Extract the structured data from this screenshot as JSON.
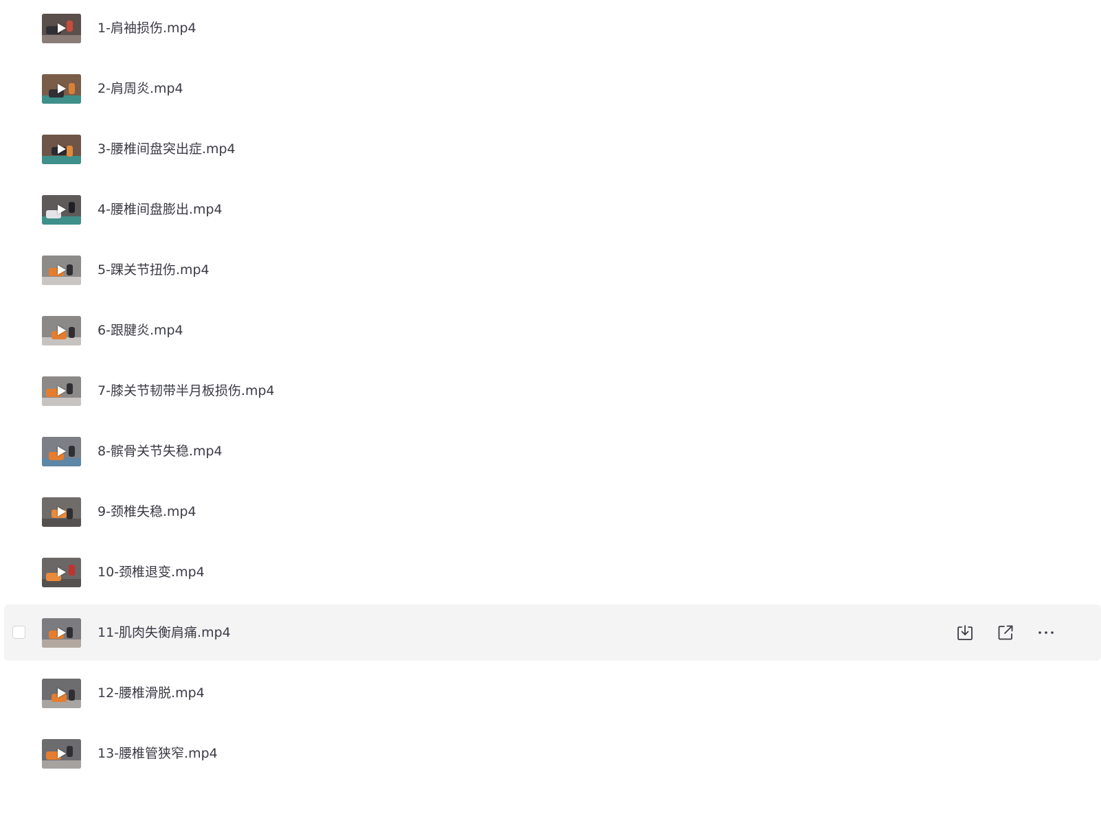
{
  "files": [
    {
      "name": "1-肩袖损伤.mp4",
      "thumb": {
        "bg": "#5b4f4c",
        "floor": "#8a7d78",
        "figure": "#2f2f35",
        "accent": "#c94c3a"
      }
    },
    {
      "name": "2-肩周炎.mp4",
      "thumb": {
        "bg": "#7a5d48",
        "floor": "#3f8f8a",
        "figure": "#2f2f35",
        "accent": "#d8803a"
      }
    },
    {
      "name": "3-腰椎间盘突出症.mp4",
      "thumb": {
        "bg": "#6e5547",
        "floor": "#3f8f8a",
        "figure": "#2a2a30",
        "accent": "#e08a3c"
      }
    },
    {
      "name": "4-腰椎间盘膨出.mp4",
      "thumb": {
        "bg": "#5e5a5a",
        "floor": "#3f8f8a",
        "figure": "#e4e4e8",
        "accent": "#1f1f25"
      }
    },
    {
      "name": "5-踝关节扭伤.mp4",
      "thumb": {
        "bg": "#8d8b89",
        "floor": "#c9c5c3",
        "figure": "#e47d2f",
        "accent": "#2f2f33"
      }
    },
    {
      "name": "6-跟腱炎.mp4",
      "thumb": {
        "bg": "#8b8987",
        "floor": "#c6c2c0",
        "figure": "#e47d2f",
        "accent": "#2f2f33"
      }
    },
    {
      "name": "7-膝关节韧带半月板损伤.mp4",
      "thumb": {
        "bg": "#8c8a88",
        "floor": "#c7c3c1",
        "figure": "#e47d2f",
        "accent": "#2f2f33"
      }
    },
    {
      "name": "8-髌骨关节失稳.mp4",
      "thumb": {
        "bg": "#7c7f86",
        "floor": "#5e86a6",
        "figure": "#e47d2f",
        "accent": "#2f2f33"
      }
    },
    {
      "name": "9-颈椎失稳.mp4",
      "thumb": {
        "bg": "#6f6c6a",
        "floor": "#55514f",
        "figure": "#ea8a3b",
        "accent": "#2f2f33"
      }
    },
    {
      "name": "10-颈椎退变.mp4",
      "thumb": {
        "bg": "#6a6766",
        "floor": "#55514f",
        "figure": "#ea8a3b",
        "accent": "#c0332f"
      }
    },
    {
      "name": "11-肌肉失衡肩痛.mp4",
      "thumb": {
        "bg": "#7c7b7f",
        "floor": "#b3a8a0",
        "figure": "#e47d2f",
        "accent": "#2f2f33"
      }
    },
    {
      "name": "12-腰椎滑脱.mp4",
      "thumb": {
        "bg": "#6d6c6e",
        "floor": "#a8a4a2",
        "figure": "#e47d2f",
        "accent": "#2f2f33"
      }
    },
    {
      "name": "13-腰椎管狭窄.mp4",
      "thumb": {
        "bg": "#6c6b6d",
        "floor": "#a6a2a0",
        "figure": "#e47d2f",
        "accent": "#2f2f33"
      }
    }
  ],
  "hovered_index": 10,
  "actions": [
    {
      "icon": "download-icon",
      "label": ""
    },
    {
      "icon": "share-icon",
      "label": ""
    },
    {
      "icon": "more-icon",
      "label": ""
    }
  ],
  "colors": {
    "hover_bg": "#f4f4f5",
    "text": "#3a3a44",
    "icon": "#3a3a44"
  }
}
